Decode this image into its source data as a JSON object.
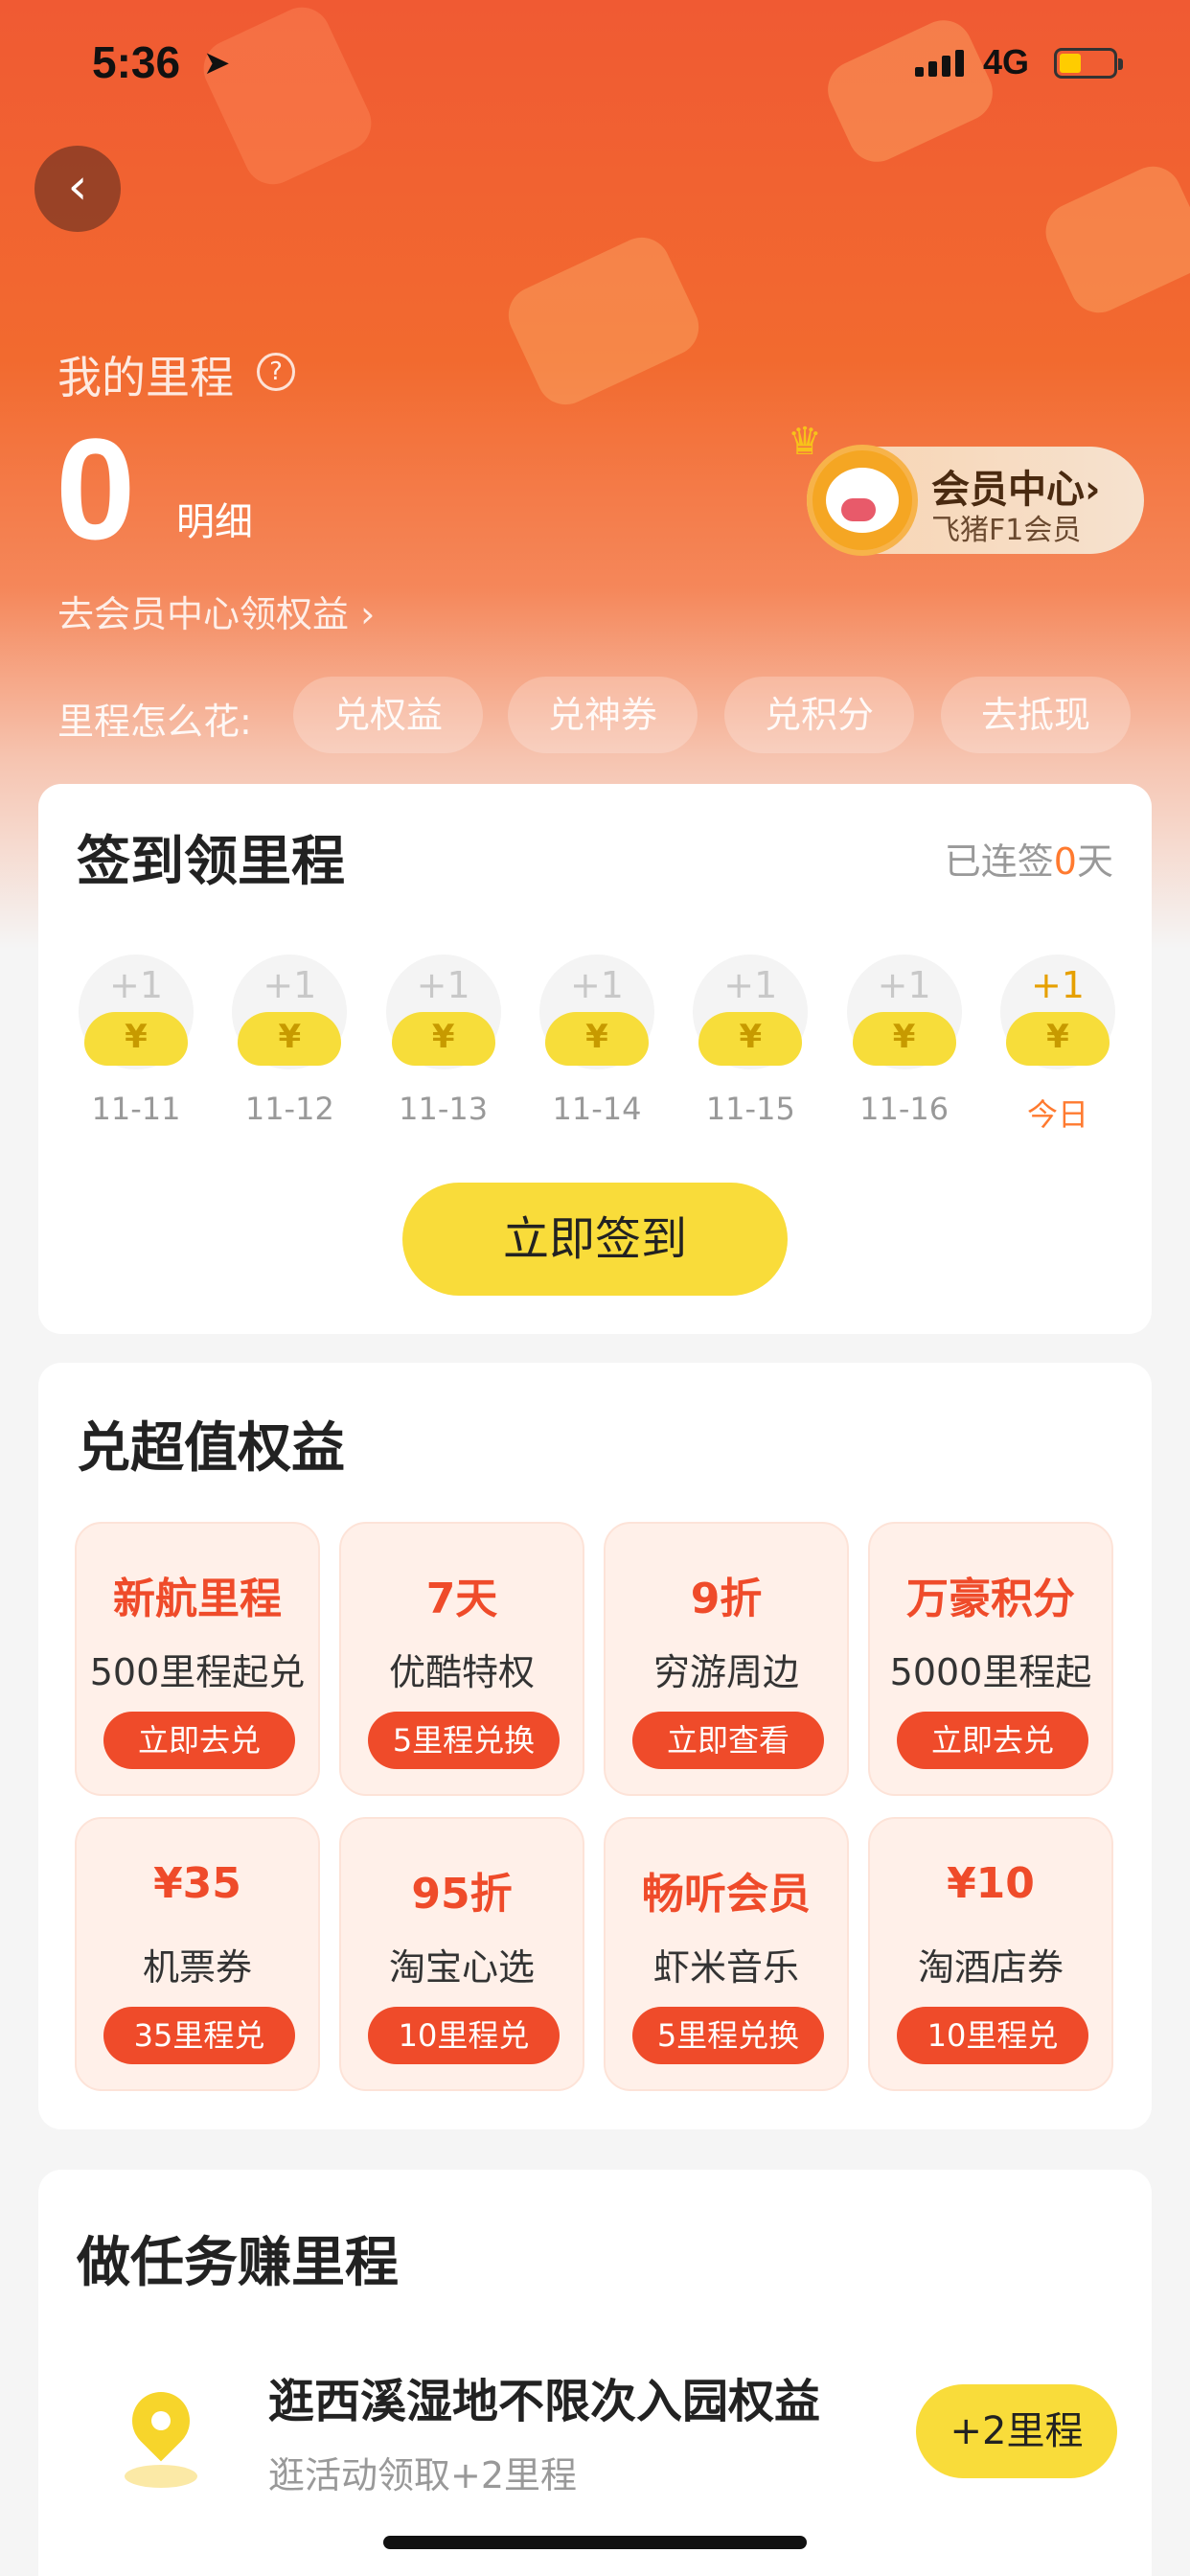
{
  "status_bar": {
    "time": "5:36",
    "network": "4G"
  },
  "header": {
    "my_miles_label": "我的里程",
    "miles_value": "0",
    "detail_label": "明细",
    "go_member_link": "去会员中心领权益 ›",
    "member_center": {
      "title": "会员中心›",
      "level": "飞猪F1会员"
    },
    "spend_label": "里程怎么花:",
    "spend_options": [
      "兑权益",
      "兑神券",
      "兑积分",
      "去抵现"
    ]
  },
  "checkin": {
    "title": "签到领里程",
    "streak_prefix": "已连签",
    "streak_days": "0",
    "streak_suffix": "天",
    "days": [
      {
        "reward": "+1",
        "date": "11-11"
      },
      {
        "reward": "+1",
        "date": "11-12"
      },
      {
        "reward": "+1",
        "date": "11-13"
      },
      {
        "reward": "+1",
        "date": "11-14"
      },
      {
        "reward": "+1",
        "date": "11-15"
      },
      {
        "reward": "+1",
        "date": "11-16"
      },
      {
        "reward": "+1",
        "date": "今日"
      }
    ],
    "button": "立即签到"
  },
  "rights": {
    "title": "兑超值权益",
    "tiles": [
      {
        "headline": "新航里程",
        "desc": "500里程起兑",
        "button": "立即去兑"
      },
      {
        "headline": "7天",
        "desc": "优酷特权",
        "button": "5里程兑换"
      },
      {
        "headline": "9折",
        "desc": "穷游周边",
        "button": "立即查看"
      },
      {
        "headline": "万豪积分",
        "desc": "5000里程起",
        "button": "立即去兑"
      },
      {
        "headline": "¥35",
        "desc": "机票券",
        "button": "35里程兑"
      },
      {
        "headline": "95折",
        "desc": "淘宝心选",
        "button": "10里程兑"
      },
      {
        "headline": "畅听会员",
        "desc": "虾米音乐",
        "button": "5里程兑换"
      },
      {
        "headline": "¥10",
        "desc": "淘酒店券",
        "button": "10里程兑"
      }
    ]
  },
  "tasks": {
    "title": "做任务赚里程",
    "items": [
      {
        "title": "逛西溪湿地不限次入园权益",
        "subtitle": "逛活动领取+2里程",
        "button": "+2里程"
      }
    ]
  },
  "colors": {
    "accent": "#ef4b2a",
    "yellow": "#f9dc3a",
    "orange": "#ff7a2f"
  }
}
